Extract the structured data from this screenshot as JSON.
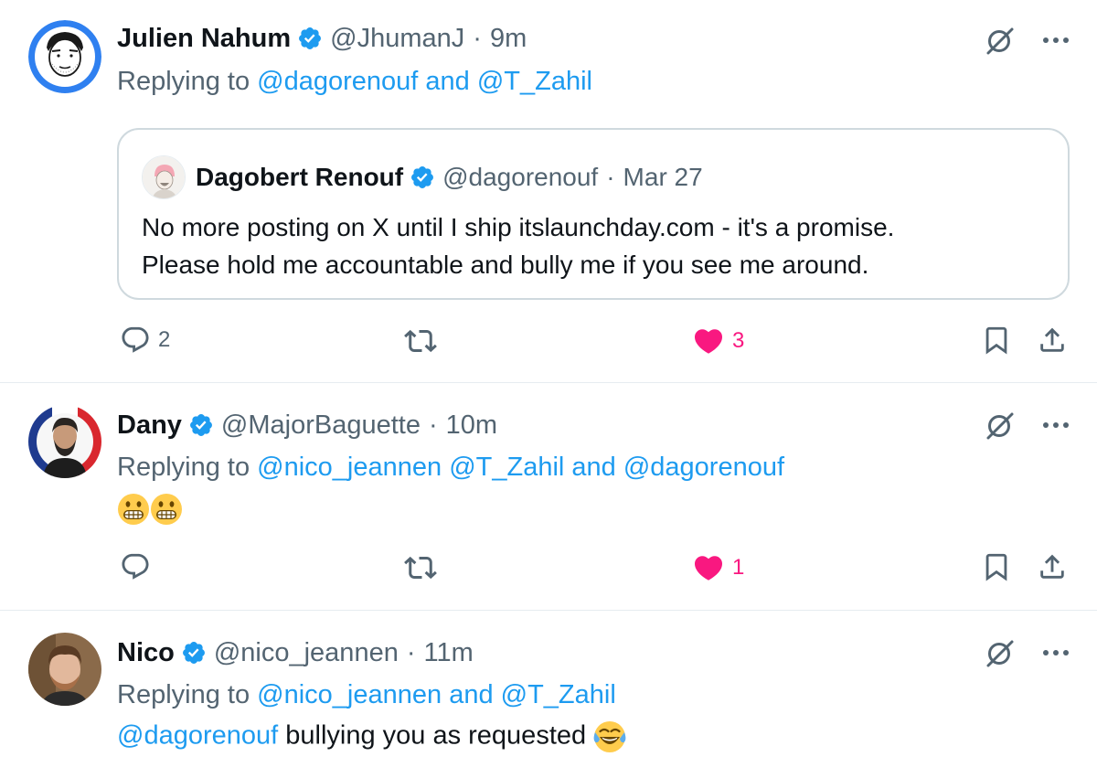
{
  "tweets": [
    {
      "name": "Julien Nahum",
      "handle": "@JhumanJ",
      "time": "9m",
      "replying_prefix": "Replying to",
      "replying_to": "@dagorenouf and @T_Zahil",
      "quote": {
        "name": "Dagobert Renouf",
        "handle": "@dagorenouf",
        "time": "Mar 27",
        "line1": "No more posting on X until I ship itslaunchday.com - it's a promise.",
        "line2": "Please hold me accountable and bully me if you see me around."
      },
      "replies": "2",
      "likes": "3",
      "liked": true
    },
    {
      "name": "Dany",
      "handle": "@MajorBaguette",
      "time": "10m",
      "replying_prefix": "Replying to",
      "replying_to": "@nico_jeannen @T_Zahil and @dagorenouf",
      "body_emoji": [
        "grimacing-face",
        "grimacing-face"
      ],
      "replies": "",
      "likes": "1",
      "liked": true
    },
    {
      "name": "Nico",
      "handle": "@nico_jeannen",
      "time": "11m",
      "replying_prefix": "Replying to",
      "replying_to": "@nico_jeannen and @T_Zahil",
      "body_mention": "@dagorenouf",
      "body_text": " bullying you as requested ",
      "body_emoji": [
        "face-with-tears-of-joy"
      ]
    }
  ],
  "sep": "·",
  "icons": [
    "verified-badge",
    "grok-icon",
    "more-icon",
    "reply-icon",
    "retweet-icon",
    "like-icon",
    "bookmark-icon",
    "share-icon"
  ],
  "colors": {
    "accent": "#1d9bf0",
    "secondary_text": "#536471",
    "like": "#f91880",
    "divider": "#e6ecf0"
  }
}
